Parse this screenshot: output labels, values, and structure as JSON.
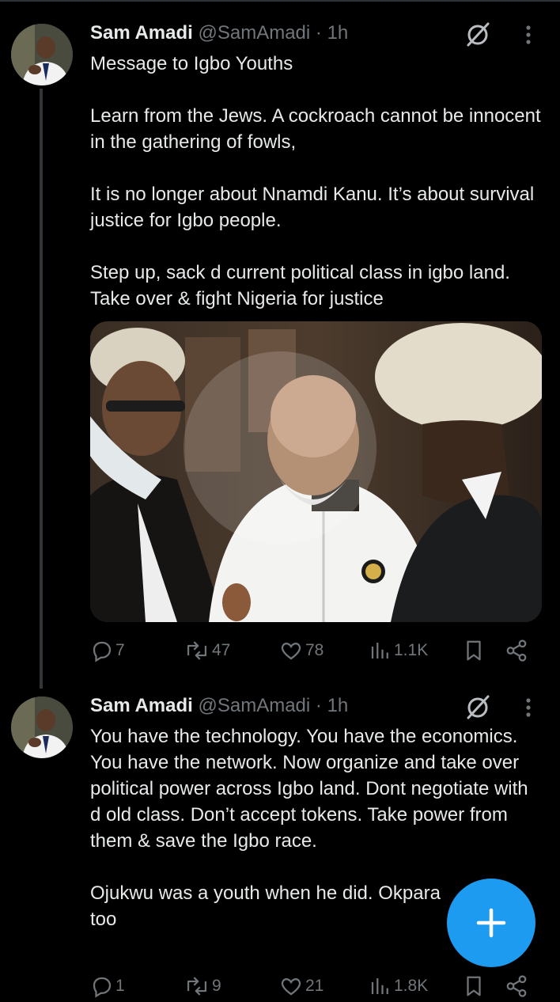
{
  "tweets": [
    {
      "author_name": "Sam Amadi",
      "author_handle": "@SamAmadi",
      "time": "· 1h",
      "paragraphs": [
        "Message to Igbo Youths",
        "Learn from the Jews. A cockroach cannot be innocent in the gathering of fowls,",
        "It is no longer about Nnamdi Kanu. It’s about survival justice for Igbo people.",
        "Step up, sack d current political class in igbo land. Take over & fight Nigeria for justice"
      ],
      "replies": "7",
      "reposts": "47",
      "likes": "78",
      "views": "1.1K"
    },
    {
      "author_name": "Sam Amadi",
      "author_handle": "@SamAmadi",
      "time": "· 1h",
      "paragraphs": [
        "You have the technology. You have the economics. You have the network. Now organize and take over political power across Igbo land. Dont negotiate with d old class. Don’t accept tokens. Take power from them & save the Igbo race.",
        "Ojukwu was a youth when he did. Okpara too"
      ],
      "replies": "1",
      "reposts": "9",
      "likes": "21",
      "views": "1.8K"
    }
  ],
  "colors": {
    "background": "#000000",
    "text": "#e7e9ea",
    "muted": "#71767b",
    "accent": "#1d9bf0"
  },
  "icons": [
    "grok-icon",
    "more-icon",
    "reply-icon",
    "repost-icon",
    "like-icon",
    "views-icon",
    "bookmark-icon",
    "share-icon",
    "plus-icon"
  ]
}
